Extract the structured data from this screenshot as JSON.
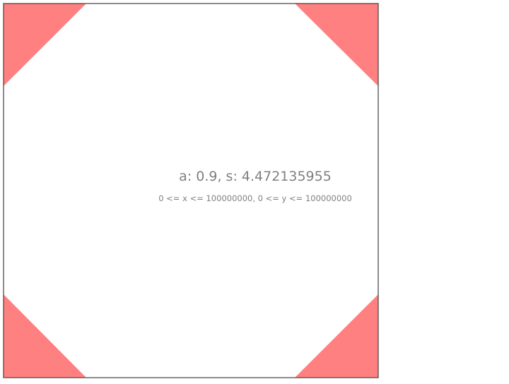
{
  "diagram": {
    "caption": "a: 0.9, s: 4.472135955",
    "range_text": "0 <= x <= 100000000, 0 <= y <= 100000000",
    "colors": {
      "frame": "#404040",
      "corner_fill": "#ff8080",
      "text": "#808080",
      "background": "#ffffff"
    },
    "corners": [
      "top-left",
      "top-right",
      "bottom-left",
      "bottom-right"
    ]
  }
}
